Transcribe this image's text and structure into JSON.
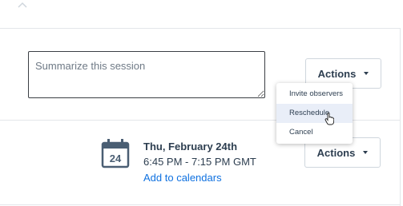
{
  "summary": {
    "placeholder": "Summarize this session"
  },
  "actions": {
    "label": "Actions"
  },
  "menu": {
    "items": [
      "Invite observers",
      "Reschedule",
      "Cancel"
    ],
    "highlighted": "Reschedule"
  },
  "session": {
    "calendar_day": "24",
    "date": "Thu, February 24th",
    "time": "6:45 PM - 7:15 PM GMT",
    "add_link": "Add to calendars"
  },
  "colors": {
    "text": "#2d3e50",
    "link": "#0f71e0",
    "highlight": "#e9eef8"
  }
}
